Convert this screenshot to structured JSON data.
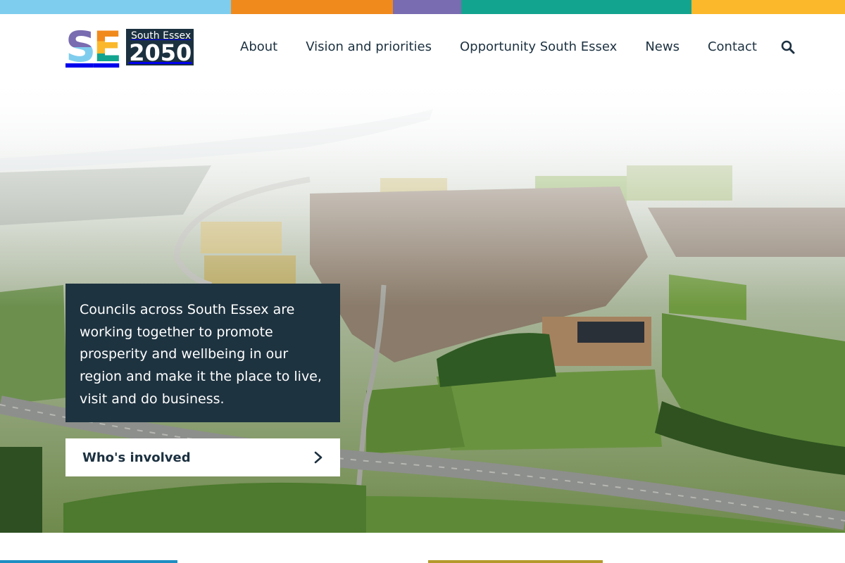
{
  "colors": {
    "stripe": [
      "#7fcdee",
      "#f18a1c",
      "#7a6cb0",
      "#13a48f",
      "#fbb82b"
    ],
    "navy": "#1c3140",
    "logo_letters": [
      "#7a6cb0",
      "#f18a1c",
      "#7fcdee",
      "#fbb82b",
      "#13a48f"
    ]
  },
  "logo": {
    "letters": "SE",
    "subtitle": "South Essex",
    "year": "2050"
  },
  "nav": {
    "items": [
      {
        "label": "About"
      },
      {
        "label": "Vision and priorities"
      },
      {
        "label": "Opportunity South Essex"
      },
      {
        "label": "News"
      },
      {
        "label": "Contact"
      }
    ],
    "search_icon": "search-icon"
  },
  "hero": {
    "intro": "Councils across South Essex are working together to promote prosperity and wellbeing in our region and make it the place to live, visit and do business.",
    "cta_label": "Who's involved",
    "cta_icon": "chevron-right-icon"
  }
}
